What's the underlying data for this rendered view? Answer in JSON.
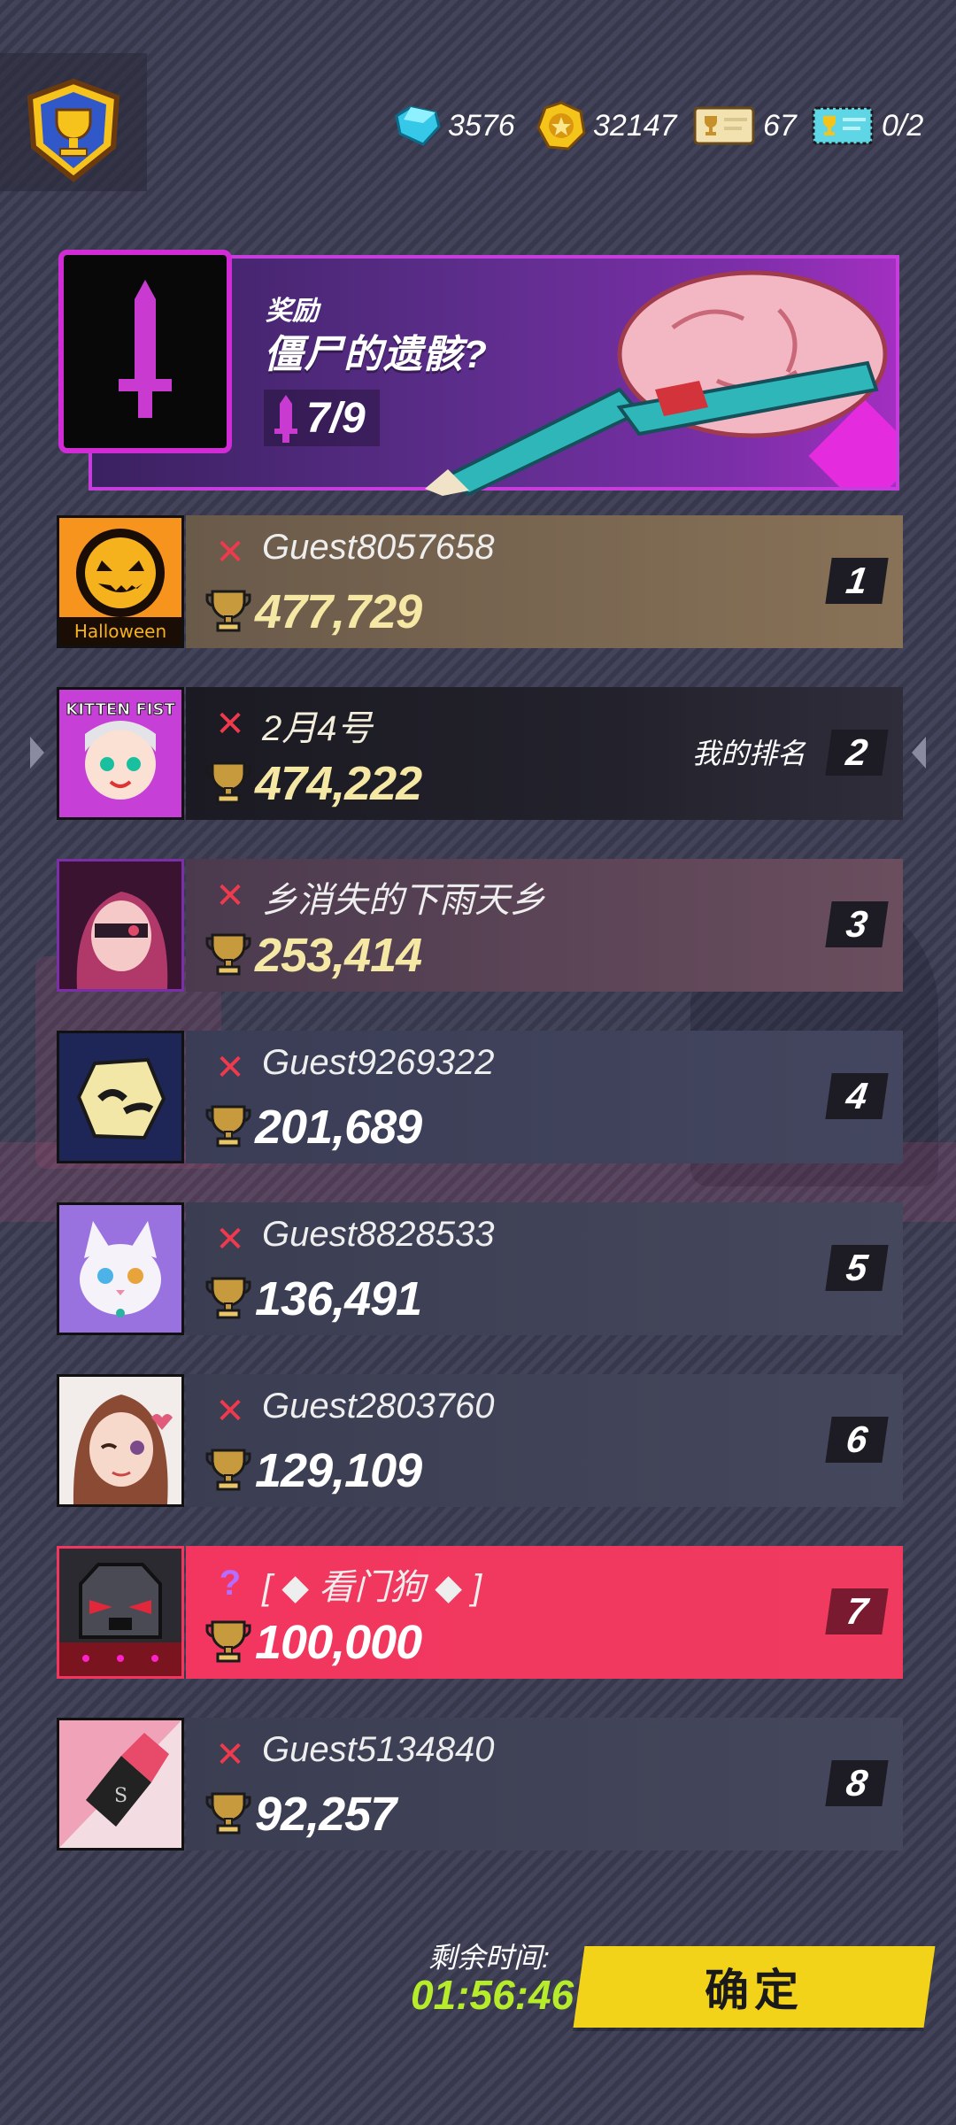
{
  "resources": [
    {
      "icon": "gem-icon",
      "value": "3576"
    },
    {
      "icon": "coin-icon",
      "value": "32147"
    },
    {
      "icon": "gold-ticket-icon",
      "value": "67"
    },
    {
      "icon": "blue-ticket-icon",
      "value": "0/2"
    }
  ],
  "reward": {
    "label": "奖励",
    "title": "僵尸的遗骸?",
    "progress": "7/9",
    "progress_current": 7,
    "progress_total": 9
  },
  "my_rank_label": "我的排名",
  "entries": [
    {
      "rank": "1",
      "name": "Guest8057658",
      "score": "477,729",
      "avatar": "halloween-pumpkin-avatar",
      "avatar_text": "Halloween",
      "status": "x"
    },
    {
      "rank": "2",
      "name": "2月4号",
      "score": "474,222",
      "avatar": "kitten-fist-avatar",
      "avatar_text": "KITTEN FIST",
      "status": "x",
      "is_me": true
    },
    {
      "rank": "3",
      "name": "乡消失的下雨天乡",
      "score": "253,414",
      "avatar": "anime-girl-avatar",
      "status": "x"
    },
    {
      "rank": "4",
      "name": "Guest9269322",
      "score": "201,689",
      "avatar": "yellow-mask-avatar",
      "status": "x"
    },
    {
      "rank": "5",
      "name": "Guest8828533",
      "score": "136,491",
      "avatar": "white-cat-avatar",
      "status": "x"
    },
    {
      "rank": "6",
      "name": "Guest2803760",
      "score": "129,109",
      "avatar": "winking-girl-avatar",
      "status": "x"
    },
    {
      "rank": "7",
      "name": "[ ◆ 看门狗 ◆ ]",
      "score": "100,000",
      "avatar": "robot-dog-avatar",
      "status": "?",
      "highlight": true
    },
    {
      "rank": "8",
      "name": "Guest5134840",
      "score": "92,257",
      "avatar": "lipstick-avatar",
      "status": "x"
    }
  ],
  "footer": {
    "time_label": "剩余时间:",
    "time_value": "01:56:46",
    "confirm_label": "确定"
  },
  "colors": {
    "accent_pink": "#f2365f",
    "confirm_yellow": "#f2d31a",
    "timer_green": "#b6ec2a",
    "score_gold": "#f5e7a4",
    "reward_purple": "#a22fc0"
  }
}
